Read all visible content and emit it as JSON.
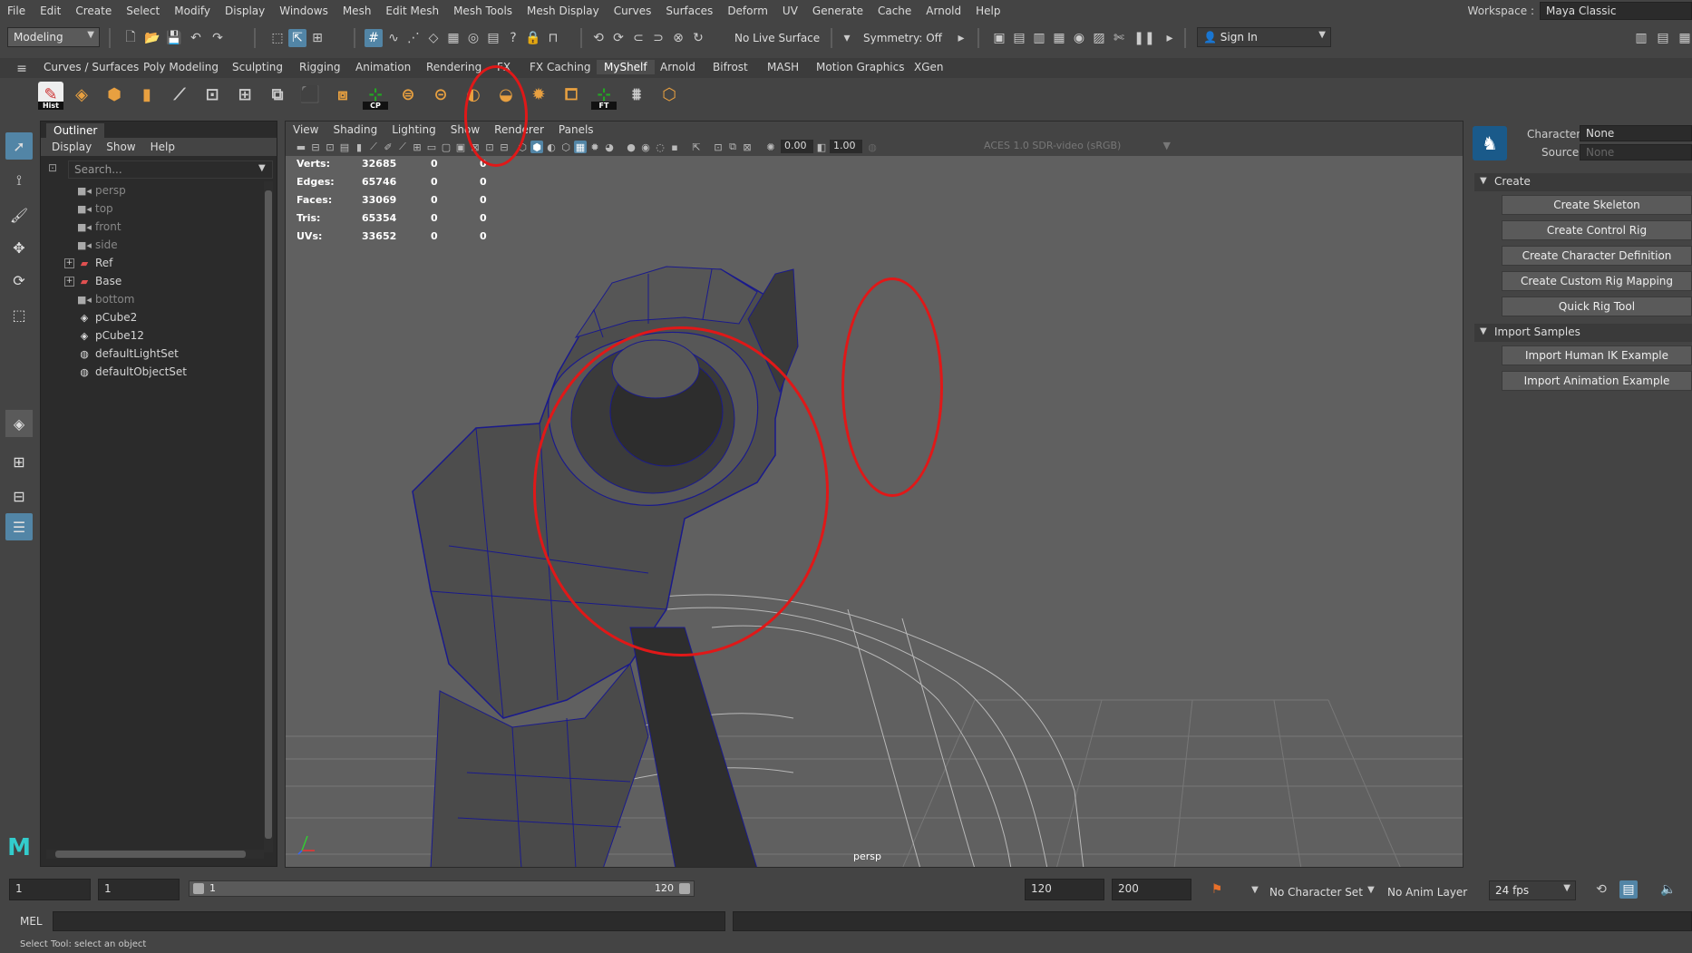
{
  "menubar": [
    "File",
    "Edit",
    "Create",
    "Select",
    "Modify",
    "Display",
    "Windows",
    "Mesh",
    "Edit Mesh",
    "Mesh Tools",
    "Mesh Display",
    "Curves",
    "Surfaces",
    "Deform",
    "UV",
    "Generate",
    "Cache",
    "Arnold",
    "Help"
  ],
  "workspace": {
    "label": "Workspace :",
    "value": "Maya Classic"
  },
  "statusline": {
    "menuset": "Modeling",
    "live_surface": "No Live Surface",
    "symmetry": "Symmetry: Off",
    "sign_in": "Sign In"
  },
  "shelf": {
    "tabs": [
      "Curves / Surfaces",
      "Poly Modeling",
      "Sculpting",
      "Rigging",
      "Animation",
      "Rendering",
      "FX",
      "FX Caching",
      "MyShelf",
      "Arnold",
      "Bifrost",
      "MASH",
      "Motion Graphics",
      "XGen"
    ],
    "active_tab": "MyShelf",
    "icon_captions": {
      "hist": "Hist",
      "cp": "CP",
      "ft": "FT"
    }
  },
  "outliner": {
    "title": "Outliner",
    "menu": [
      "Display",
      "Show",
      "Help"
    ],
    "search_placeholder": "Search...",
    "items": [
      {
        "name": "persp",
        "icon": "camera-icon"
      },
      {
        "name": "top",
        "icon": "camera-icon"
      },
      {
        "name": "front",
        "icon": "camera-icon"
      },
      {
        "name": "side",
        "icon": "camera-icon"
      },
      {
        "name": "Ref",
        "icon": "reference-icon"
      },
      {
        "name": "Base",
        "icon": "reference-icon"
      },
      {
        "name": "bottom",
        "icon": "camera-icon"
      },
      {
        "name": "pCube2",
        "icon": "mesh-icon"
      },
      {
        "name": "pCube12",
        "icon": "mesh-icon"
      },
      {
        "name": "defaultLightSet",
        "icon": "set-icon"
      },
      {
        "name": "defaultObjectSet",
        "icon": "set-icon"
      }
    ]
  },
  "viewport": {
    "menu": [
      "View",
      "Shading",
      "Lighting",
      "Show",
      "Renderer",
      "Panels"
    ],
    "exposure": "0.00",
    "gamma": "1.00",
    "colorspace": "ACES 1.0 SDR-video (sRGB)",
    "camera_label": "persp",
    "hud": [
      {
        "label": "Verts:",
        "v1": "32685",
        "v2": "0",
        "v3": "0"
      },
      {
        "label": "Edges:",
        "v1": "65746",
        "v2": "0",
        "v3": "0"
      },
      {
        "label": "Faces:",
        "v1": "33069",
        "v2": "0",
        "v3": "0"
      },
      {
        "label": "Tris:",
        "v1": "65354",
        "v2": "0",
        "v3": "0"
      },
      {
        "label": "UVs:",
        "v1": "33652",
        "v2": "0",
        "v3": "0"
      }
    ]
  },
  "human_ik": {
    "character_label": "Character:",
    "character_value": "None",
    "source_label": "Source:",
    "source_value": "None",
    "section_create": "Create",
    "create_buttons": [
      "Create Skeleton",
      "Create Control Rig",
      "Create Character Definition",
      "Create Custom Rig Mapping",
      "Quick Rig Tool"
    ],
    "section_import": "Import Samples",
    "import_buttons": [
      "Import Human IK Example",
      "Import Animation Example"
    ]
  },
  "timeline": {
    "start": "1",
    "current": "1",
    "range_start": "1",
    "range_end": "120",
    "playback_end": "120",
    "anim_end": "200",
    "character_set": "No Character Set",
    "anim_layer": "No Anim Layer",
    "fps": "24 fps"
  },
  "command_line": {
    "label": "MEL"
  },
  "help_line": "Select Tool: select an object",
  "colors": {
    "accent": "#5285a6",
    "annotation": "#e01818",
    "wire": "#1a1a8c"
  }
}
